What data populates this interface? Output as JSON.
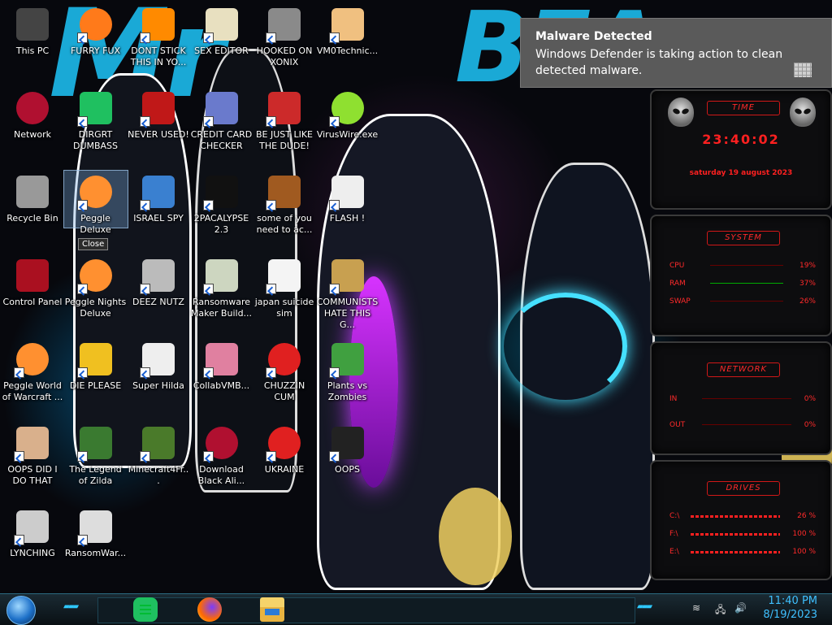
{
  "desktop": {
    "icons": [
      {
        "label": "This PC",
        "icon": "monitor-icon"
      },
      {
        "label": "FURRY FUX",
        "icon": "firefox-icon"
      },
      {
        "label": "DONT STICK THIS IN YO...",
        "icon": "vlc-cone-icon"
      },
      {
        "label": "SEX EDITOR",
        "icon": "xd-editor-icon"
      },
      {
        "label": "HOOKED ON XONIX",
        "icon": "xonix-game-icon"
      },
      {
        "label": "VM0Technic...",
        "icon": "doctor-person-icon"
      },
      {
        "label": "Network",
        "icon": "network-orb-icon"
      },
      {
        "label": "DIRGRT DUMBASS",
        "icon": "green-chat-icon"
      },
      {
        "label": "NEVER USED!",
        "icon": "dev-cpp-icon"
      },
      {
        "label": "CREDIT CARD CHECKER",
        "icon": "credit-card-icon"
      },
      {
        "label": "BE JUST LIKE THE DUDE!",
        "icon": "santa-character-icon"
      },
      {
        "label": "VirusWire.exe",
        "icon": "lime-slice-icon"
      },
      {
        "label": "Recycle Bin",
        "icon": "recycle-bin-icon"
      },
      {
        "label": "Peggle Deluxe",
        "icon": "peggle-icon"
      },
      {
        "label": "ISRAEL SPY",
        "icon": "spy-program-icon"
      },
      {
        "label": "2PACALYPSE 2.3",
        "icon": "terminal-icon"
      },
      {
        "label": "some of you need to ac...",
        "icon": "cartoon-dog-icon"
      },
      {
        "label": "FLASH !",
        "icon": "flash-file-icon"
      },
      {
        "label": "Control Panel",
        "icon": "control-panel-icon"
      },
      {
        "label": "Peggle Nights Deluxe",
        "icon": "peggle-nights-icon"
      },
      {
        "label": "DEEZ NUTZ",
        "icon": "windows-stack-icon"
      },
      {
        "label": "Ransomware Maker Build...",
        "icon": "app-window-icon"
      },
      {
        "label": "japan suicide sim",
        "icon": "document-icon"
      },
      {
        "label": "COMMUNISTS HATE THIS G...",
        "icon": "money-bag-icon"
      },
      {
        "label": "Peggle World of Warcraft ...",
        "icon": "peggle-wow-icon"
      },
      {
        "label": "DIE PLEASE",
        "icon": "de-yellow-icon"
      },
      {
        "label": "Super Hilda",
        "icon": "pixel-character-icon"
      },
      {
        "label": "CollabVMB...",
        "icon": "vm-window-icon"
      },
      {
        "label": "CHUZZIN CUM",
        "icon": "red-chuzzle-icon"
      },
      {
        "label": "Plants vs Zombies",
        "icon": "plant-icon"
      },
      {
        "label": "OOPS DID I DO THAT",
        "icon": "portrait-painting-icon"
      },
      {
        "label": "The Legend of Zilda",
        "icon": "pixel-hero-icon"
      },
      {
        "label": "Minecraft4Fr...",
        "icon": "minecraft-block-icon"
      },
      {
        "label": "Download Black Ali...",
        "icon": "alien-orb-icon"
      },
      {
        "label": "UKRAINE",
        "icon": "radiation-icon"
      },
      {
        "label": "OOPS",
        "icon": "dark-tablet-icon"
      },
      {
        "label": "LYNCHING",
        "icon": "virus-shield-icon"
      },
      {
        "label": "RansomWar...",
        "icon": "skull-icon"
      }
    ],
    "tooltip": "Close"
  },
  "notification": {
    "title": "Malware Detected",
    "message": "Windows Defender is taking action to clean detected malware."
  },
  "gadgets": {
    "time": {
      "title": "TIME",
      "clock": "23:40:02",
      "date": "saturday 19 august 2023"
    },
    "system": {
      "title": "SYSTEM",
      "rows": [
        {
          "label": "CPU",
          "value": "19%"
        },
        {
          "label": "RAM",
          "value": "37%"
        },
        {
          "label": "SWAP",
          "value": "26%"
        }
      ]
    },
    "network": {
      "title": "NETWORK",
      "rows": [
        {
          "label": "IN",
          "value": "0%"
        },
        {
          "label": "OUT",
          "value": "0%"
        }
      ]
    },
    "drives": {
      "title": "DRIVES",
      "rows": [
        {
          "label": "C:\\",
          "value": "26 %"
        },
        {
          "label": "F:\\",
          "value": "100 %"
        },
        {
          "label": "E:\\",
          "value": "100 %"
        }
      ]
    }
  },
  "taskbar": {
    "pinned": [
      {
        "icon": "green-chat-icon"
      },
      {
        "icon": "firefox-icon"
      },
      {
        "icon": "file-explorer-icon"
      }
    ],
    "time": "11:40 PM",
    "date": "8/19/2023"
  },
  "colors": {
    "accent": "#1aa9d6",
    "gadget_red": "#ff2020",
    "toast_bg": "#5a5a5a",
    "clock": "#3fc0ff"
  }
}
